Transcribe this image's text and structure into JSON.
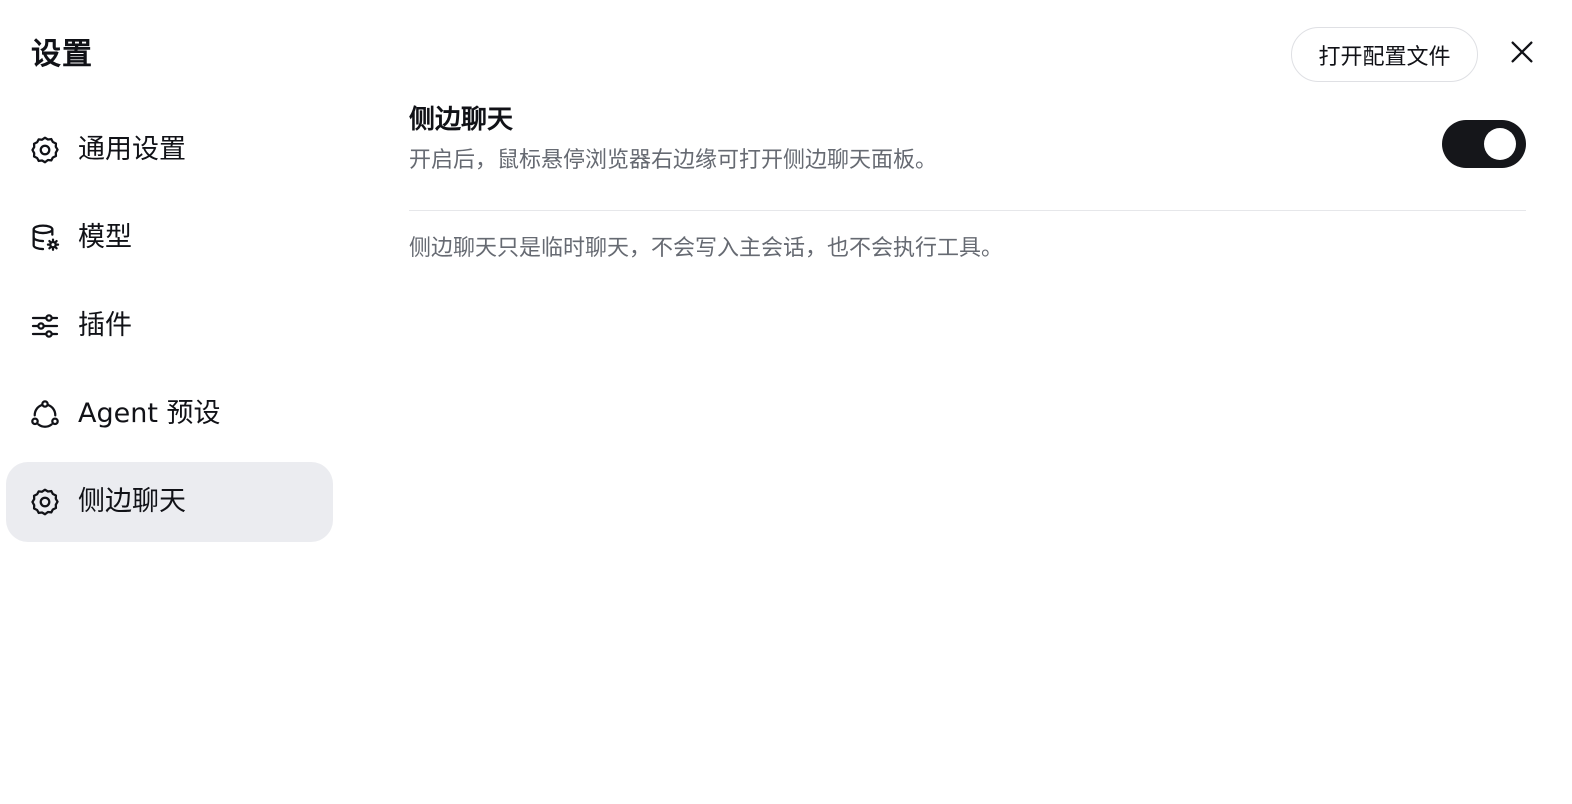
{
  "header": {
    "title": "设置",
    "open_config_label": "打开配置文件",
    "close_icon": "close-icon"
  },
  "sidebar": {
    "items": [
      {
        "label": "通用设置",
        "icon": "gear-icon",
        "active": false
      },
      {
        "label": "模型",
        "icon": "database-settings-icon",
        "active": false
      },
      {
        "label": "插件",
        "icon": "sliders-icon",
        "active": false
      },
      {
        "label": "Agent 预设",
        "icon": "agent-nodes-icon",
        "active": false
      },
      {
        "label": "侧边聊天",
        "icon": "gear-icon",
        "active": true
      }
    ]
  },
  "main": {
    "section_title": "侧边聊天",
    "section_description": "开启后，鼠标悬停浏览器右边缘可打开侧边聊天面板。",
    "toggle_on": true,
    "note": "侧边聊天只是临时聊天，不会写入主会话，也不会执行工具。"
  },
  "colors": {
    "active_item_bg": "#ebecf0",
    "toggle_on": "#15161a",
    "secondary_text": "#666a72"
  }
}
